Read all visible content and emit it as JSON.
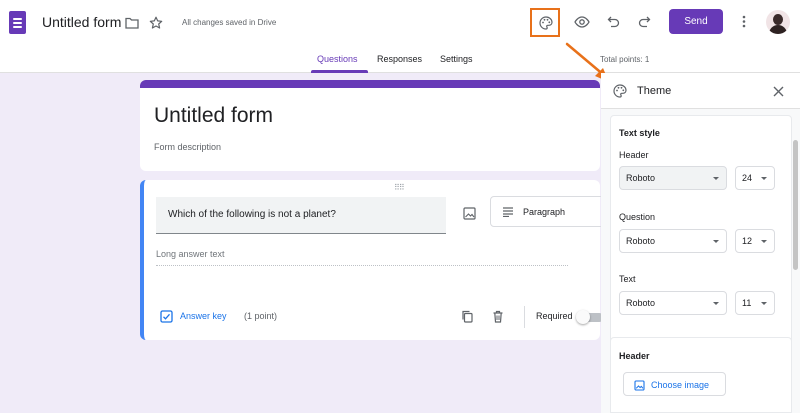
{
  "header": {
    "form_title": "Untitled form",
    "save_status": "All changes saved in Drive",
    "send_label": "Send"
  },
  "icons": {
    "app": "forms-app-icon",
    "folder": "folder-icon",
    "star": "star-icon",
    "palette": "palette-icon",
    "preview": "eye-icon",
    "undo": "undo-icon",
    "redo": "redo-icon",
    "more": "more-vert-icon",
    "image": "image-icon",
    "paragraph": "paragraph-icon",
    "copy": "copy-icon",
    "delete": "trash-icon",
    "answer_key": "checkbox-icon",
    "close": "close-icon"
  },
  "tabs": [
    {
      "label": "Questions",
      "active": true
    },
    {
      "label": "Responses",
      "active": false
    },
    {
      "label": "Settings",
      "active": false
    }
  ],
  "total_points": "Total points: 1",
  "title_card": {
    "title": "Untitled form",
    "description_placeholder": "Form description"
  },
  "question": {
    "text": "Which of the following is not a planet?",
    "type": "Paragraph",
    "answer_placeholder": "Long answer text",
    "answer_key_label": "Answer key",
    "points": "(1 point)",
    "required_label": "Required",
    "required": false
  },
  "theme_panel": {
    "title": "Theme",
    "text_style_title": "Text style",
    "header_label": "Header",
    "header_font": "Roboto",
    "header_size": "24",
    "question_label": "Question",
    "question_font": "Roboto",
    "question_size": "12",
    "text_label": "Text",
    "text_font": "Roboto",
    "text_size": "11",
    "header_image_title": "Header",
    "choose_image_label": "Choose image"
  },
  "colors": {
    "accent": "#673ab7",
    "background": "#f0ebf8",
    "highlight": "#e8711a",
    "link": "#1a73e8",
    "active_border": "#4285f4"
  }
}
